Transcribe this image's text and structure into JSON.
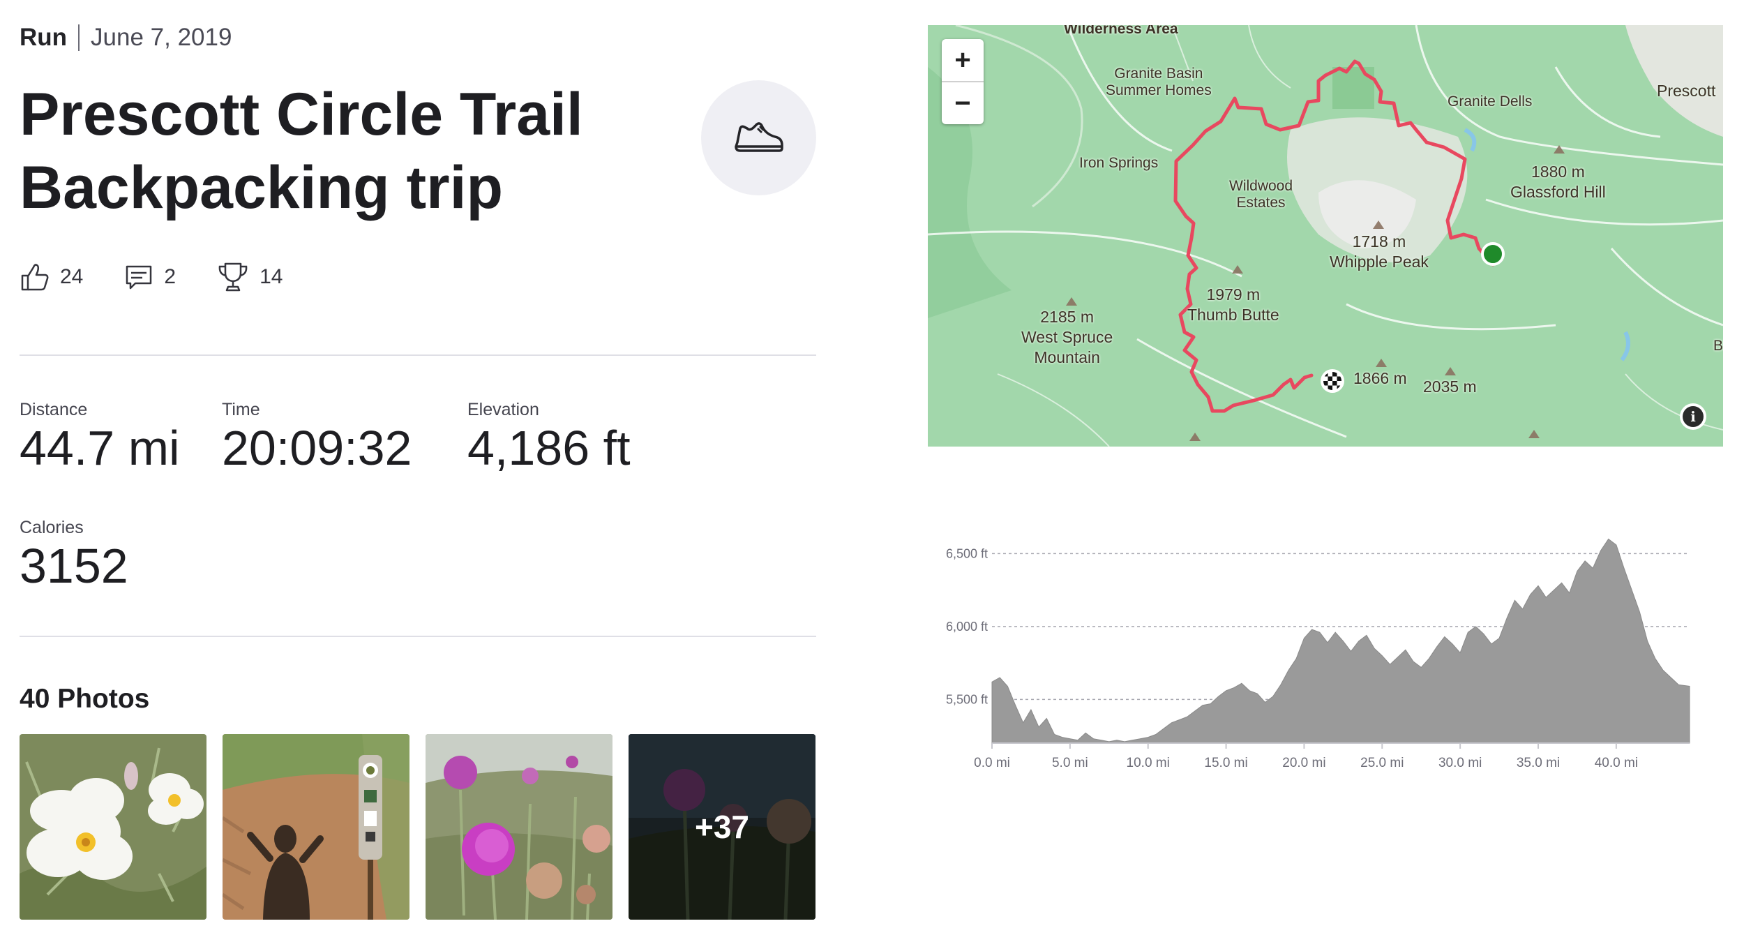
{
  "activity": {
    "type": "Run",
    "date": "June 7, 2019",
    "title": "Prescott Circle Trail Backpacking trip",
    "sport_icon": "running-shoe-icon"
  },
  "social": {
    "kudos": "24",
    "comments": "2",
    "achievements": "14"
  },
  "stats": [
    {
      "label": "Distance",
      "value": "44.7 mi"
    },
    {
      "label": "Time",
      "value": "20:09:32"
    },
    {
      "label": "Elevation",
      "value": "4,186 ft"
    },
    {
      "label": "Calories",
      "value": "3152"
    }
  ],
  "photos": {
    "title": "40 Photos",
    "more": "+37"
  },
  "map": {
    "zoom_in": "+",
    "zoom_out": "−",
    "info": "i",
    "labels": {
      "wilderness": "Wilderness Area",
      "granite_basin": "Granite Basin\nSummer Homes",
      "granite_dells": "Granite Dells",
      "prescott": "Prescott",
      "iron_springs": "Iron Springs",
      "wildwood": "Wildwood\nEstates",
      "glassford": "1880 m\nGlassford Hill",
      "whipple": "1718 m\nWhipple Peak",
      "thumb": "1979 m\nThumb Butte",
      "spruce": "2185 m\nWest Spruce\nMountain",
      "peak1866": "1866 m",
      "peak2035": "2035 m",
      "edge": "Bl"
    },
    "route_color": "#e8485f",
    "start_color": "#1f8a2a"
  },
  "chart_data": {
    "type": "area",
    "title": "",
    "xlabel": "",
    "ylabel": "",
    "x_ticks": [
      "0.0 mi",
      "5.0 mi",
      "10.0 mi",
      "15.0 mi",
      "20.0 mi",
      "25.0 mi",
      "30.0 mi",
      "35.0 mi",
      "40.0 mi"
    ],
    "y_ticks": [
      "6,500 ft",
      "6,000 ft",
      "5,500 ft"
    ],
    "xlim": [
      0,
      44.7
    ],
    "ylim": [
      5200,
      6660
    ],
    "grid": true,
    "x": [
      0,
      0.5,
      1,
      1.5,
      2,
      2.5,
      3,
      3.5,
      4,
      4.5,
      5,
      5.5,
      6,
      6.5,
      7,
      7.5,
      8,
      8.5,
      9,
      9.5,
      10,
      10.5,
      11,
      11.5,
      12,
      12.5,
      13,
      13.5,
      14,
      14.5,
      15,
      15.5,
      16,
      16.5,
      17,
      17.5,
      18,
      18.5,
      19,
      19.5,
      20,
      20.5,
      21,
      21.5,
      22,
      22.5,
      23,
      23.5,
      24,
      24.5,
      25,
      25.5,
      26,
      26.5,
      27,
      27.5,
      28,
      28.5,
      29,
      29.5,
      30,
      30.5,
      31,
      31.5,
      32,
      32.5,
      33,
      33.5,
      34,
      34.5,
      35,
      35.5,
      36,
      36.5,
      37,
      37.5,
      38,
      38.5,
      39,
      39.5,
      40,
      40.5,
      41,
      41.5,
      42,
      42.5,
      43,
      43.5,
      44,
      44.7
    ],
    "y": [
      5620,
      5650,
      5590,
      5460,
      5340,
      5430,
      5310,
      5370,
      5260,
      5240,
      5230,
      5220,
      5270,
      5230,
      5220,
      5210,
      5220,
      5210,
      5220,
      5230,
      5240,
      5260,
      5300,
      5340,
      5360,
      5380,
      5420,
      5460,
      5470,
      5520,
      5560,
      5580,
      5610,
      5560,
      5540,
      5480,
      5520,
      5600,
      5700,
      5780,
      5920,
      5980,
      5960,
      5890,
      5960,
      5900,
      5830,
      5900,
      5940,
      5850,
      5800,
      5740,
      5790,
      5840,
      5760,
      5720,
      5780,
      5860,
      5930,
      5880,
      5820,
      5960,
      6000,
      5950,
      5880,
      5920,
      6060,
      6180,
      6120,
      6220,
      6280,
      6200,
      6250,
      6300,
      6230,
      6380,
      6450,
      6400,
      6520,
      6600,
      6560,
      6400,
      6250,
      6100,
      5900,
      5780,
      5700,
      5650,
      5600,
      5590
    ]
  }
}
